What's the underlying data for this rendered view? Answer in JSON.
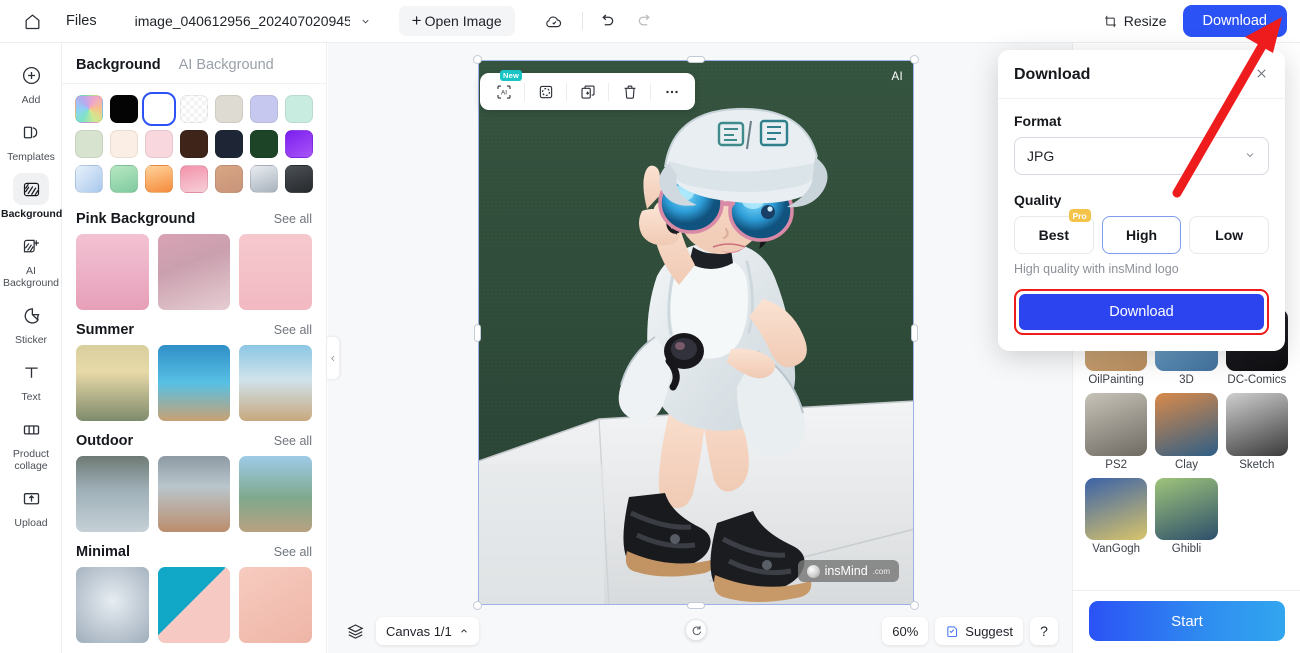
{
  "topbar": {
    "home_icon": "home-icon",
    "files_label": "Files",
    "file_name": "image_040612956_202407020945...",
    "open_image_label": "Open Image",
    "cloud_icon": "cloud-sync-icon",
    "undo_icon": "undo-icon",
    "redo_icon": "redo-icon",
    "resize_label": "Resize",
    "download_label": "Download"
  },
  "rail": {
    "items": [
      {
        "label": "Add",
        "icon": "plus-circle-icon",
        "active": false
      },
      {
        "label": "Templates",
        "icon": "templates-icon",
        "active": false
      },
      {
        "label": "Background",
        "icon": "background-icon",
        "active": true
      },
      {
        "label": "AI Background",
        "icon": "ai-background-icon",
        "active": false
      },
      {
        "label": "Sticker",
        "icon": "sticker-icon",
        "active": false
      },
      {
        "label": "Text",
        "icon": "text-icon",
        "active": false
      },
      {
        "label": "Product collage",
        "icon": "collage-icon",
        "active": false
      },
      {
        "label": "Upload",
        "icon": "upload-icon",
        "active": false
      }
    ]
  },
  "panel": {
    "tabs": [
      {
        "label": "Background",
        "active": true
      },
      {
        "label": "AI Background",
        "active": false
      }
    ],
    "swatches": [
      {
        "name": "rainbow",
        "color": "conic-gradient(from 210deg, #7fe3c6, #8fd0f5, #b9a8ee, #f0a6c8, #f6c48a, #cfe98f, #7fe3c6)",
        "selected": false
      },
      {
        "name": "black",
        "color": "#040404",
        "selected": false
      },
      {
        "name": "white",
        "color": "#ffffff",
        "selected": true
      },
      {
        "name": "transparent",
        "color": "repeating-conic-gradient(#fff 0% 25%, #f3f3f3 0% 50%) 50%/8px 8px",
        "selected": false
      },
      {
        "name": "beige",
        "color": "#dedbd2",
        "selected": false
      },
      {
        "name": "periwinkle",
        "color": "#c7c8ef",
        "selected": false
      },
      {
        "name": "mint",
        "color": "#c9ece0",
        "selected": false
      },
      {
        "name": "sage",
        "color": "#d7e3cf",
        "selected": false
      },
      {
        "name": "cream",
        "color": "#fbeee4",
        "selected": false
      },
      {
        "name": "blush",
        "color": "#f8d7de",
        "selected": false
      },
      {
        "name": "dark-brown",
        "color": "#3e2419",
        "selected": false
      },
      {
        "name": "navy",
        "color": "#1e2636",
        "selected": false
      },
      {
        "name": "forest-green",
        "color": "#1e4427",
        "selected": false
      },
      {
        "name": "violet",
        "color": "linear-gradient(150deg,#7a1ef0,#a855f7)",
        "selected": false
      },
      {
        "name": "sky-gradient",
        "color": "linear-gradient(135deg,#e8f1fb,#a8c8ec)",
        "selected": false
      },
      {
        "name": "green-gradient",
        "color": "linear-gradient(160deg,#b7e8c1,#7fc9a0)",
        "selected": false
      },
      {
        "name": "orange-gradient",
        "color": "linear-gradient(165deg,#ffd29a,#f58b3c)",
        "selected": false
      },
      {
        "name": "pink-gradient",
        "color": "linear-gradient(165deg,#f392ab,#f6cfd6)",
        "selected": false
      },
      {
        "name": "tan-gradient",
        "color": "linear-gradient(160deg,#d8a583,#c9947a)",
        "selected": false
      },
      {
        "name": "silver-gradient",
        "color": "linear-gradient(160deg,#e8ecf0,#a8b2bd)",
        "selected": false
      },
      {
        "name": "charcoal-gradient",
        "color": "linear-gradient(160deg,#4b5055,#26292c)",
        "selected": false
      }
    ],
    "sections": [
      {
        "title": "Pink Background",
        "see_all": "See all",
        "thumbs": [
          {
            "name": "pink-petals-podium",
            "css": "linear-gradient(180deg,#f3c2d2 0%, #edb3c8 45%, #e79fb8 100%)"
          },
          {
            "name": "pink-room-window",
            "css": "linear-gradient(160deg,#d9a2b4 0%, #caa0ae 40%, #e6cdd2 100%)"
          },
          {
            "name": "pink-tulips",
            "css": "linear-gradient(180deg,#f6c9cf 0%, #f2b9c2 100%)"
          }
        ]
      },
      {
        "title": "Summer",
        "see_all": "See all",
        "thumbs": [
          {
            "name": "beach-sunset-palms",
            "css": "linear-gradient(180deg,#d8cf9e 0%, #e8d9a8 35%, #7e8b6c 100%)"
          },
          {
            "name": "pool-water-deck",
            "css": "linear-gradient(180deg,#2f8fc7 0%, #58c0e4 50%, #c9a173 100%)"
          },
          {
            "name": "ocean-sand-beach",
            "css": "linear-gradient(180deg,#8cc6e4 0%, #cfe3ec 45%, #c8a87e 100%)"
          }
        ]
      },
      {
        "title": "Outdoor",
        "see_all": "See all",
        "thumbs": [
          {
            "name": "forest-wet-ground",
            "css": "linear-gradient(180deg,#6d7a74 0%, #9fb0b8 45%, #c5d0d6 100%)"
          },
          {
            "name": "coastal-cliff-deck",
            "css": "linear-gradient(180deg,#8d9aa4 0%, #b9c6cc 40%, #bb8d6d 100%)"
          },
          {
            "name": "mountain-pine-view",
            "css": "linear-gradient(180deg,#9ecbe8 0%, #7fa98c 55%, #b8a180 100%)"
          }
        ]
      },
      {
        "title": "Minimal",
        "see_all": "See all",
        "thumbs": [
          {
            "name": "grey-blue-soft",
            "css": "radial-gradient(circle at 50% 45%, #e7edf2, #9fadbb)"
          },
          {
            "name": "teal-pink-diagonal",
            "css": "linear-gradient(135deg,#11a8c8 0%, #11a8c8 46%, #f6c9c2 46%, #f6c9c2 100%)"
          },
          {
            "name": "peach-soft",
            "css": "linear-gradient(150deg,#f7cbc0, #eeb5a6)"
          }
        ]
      }
    ],
    "collapse_icon": "chevron-left-icon"
  },
  "canvas": {
    "object_toolbar": [
      {
        "name": "ai-edit",
        "icon": "ai-frame-icon",
        "badge": "New"
      },
      {
        "name": "refine-cutout",
        "icon": "circle-dashed-icon",
        "badge": ""
      },
      {
        "name": "duplicate",
        "icon": "duplicate-icon",
        "badge": ""
      },
      {
        "name": "delete",
        "icon": "trash-icon",
        "badge": ""
      },
      {
        "name": "more",
        "icon": "ellipsis-icon",
        "badge": ""
      }
    ],
    "ai_tag": "AI",
    "watermark_text": "insMind",
    "watermark_suffix": ".com",
    "rotate_icon": "rotate-icon"
  },
  "bottombar": {
    "layers_icon": "layers-icon",
    "canvas_label": "Canvas 1/1",
    "canvas_caret": "chevron-up-icon",
    "zoom_level": "60%",
    "suggest_label": "Suggest",
    "suggest_icon": "suggest-note-icon",
    "help_label": "?"
  },
  "right_panel": {
    "styles": [
      {
        "label": "OilPainting",
        "css": "linear-gradient(160deg,#d8b88c,#b98d5e)"
      },
      {
        "label": "3D",
        "css": "linear-gradient(160deg,#8fc6e8,#3f6f9c)"
      },
      {
        "label": "DC-Comics",
        "css": "linear-gradient(160deg,#2a2a30,#0d0d10)"
      },
      {
        "label": "PS2",
        "css": "linear-gradient(160deg,#c8c3b8,#6f6a62)"
      },
      {
        "label": "Clay",
        "css": "linear-gradient(160deg,#d98a4a,#2e5e86)"
      },
      {
        "label": "Sketch",
        "css": "linear-gradient(160deg,#cfcfcf,#3a3a3a)"
      },
      {
        "label": "VanGogh",
        "css": "linear-gradient(160deg,#3b62a8,#d8c46a)"
      },
      {
        "label": "Ghibli",
        "css": "linear-gradient(160deg,#9fc47a,#2d4f6b)"
      }
    ],
    "start_label": "Start"
  },
  "download_popup": {
    "title": "Download",
    "close_icon": "close-icon",
    "format_label": "Format",
    "format_value": "JPG",
    "format_caret": "chevron-down-icon",
    "quality_label": "Quality",
    "quality_options": [
      {
        "label": "Best",
        "badge": "Pro",
        "selected": false
      },
      {
        "label": "High",
        "badge": "",
        "selected": true
      },
      {
        "label": "Low",
        "badge": "",
        "selected": false
      }
    ],
    "hint": "High quality with insMind logo",
    "cta_label": "Download"
  },
  "annotations": {
    "arrow_color": "#ee1c1c",
    "highlight_color": "#ef1c1c"
  }
}
